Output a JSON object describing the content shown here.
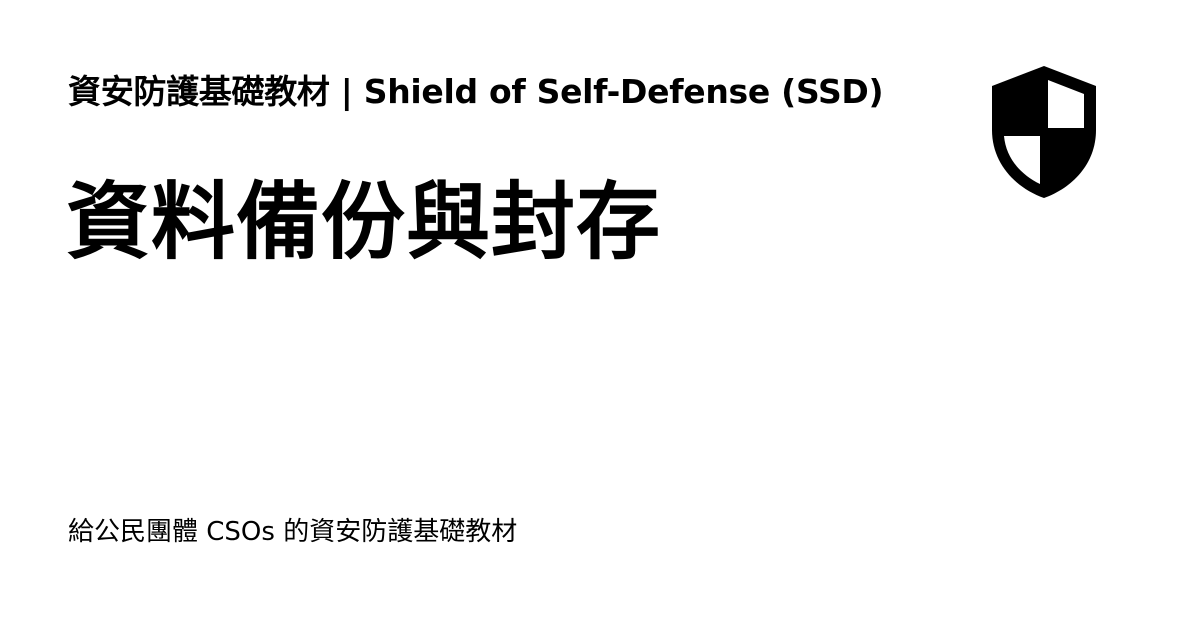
{
  "header": {
    "site_title": "資安防護基礎教材 | Shield of Self-Defense (SSD)"
  },
  "page": {
    "title": "資料備份與封存"
  },
  "footer": {
    "tagline": "給公民團體 CSOs 的資安防護基礎教材"
  },
  "logo": {
    "icon": "shield-icon",
    "color": "#000000"
  }
}
